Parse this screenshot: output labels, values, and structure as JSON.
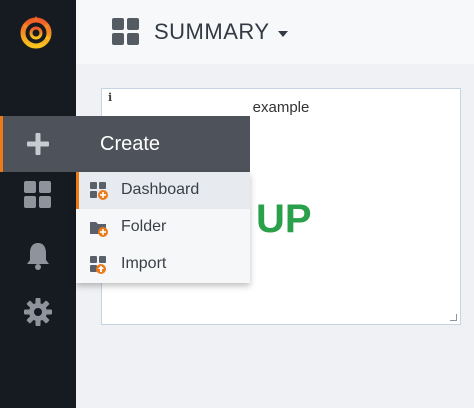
{
  "header": {
    "dashboard_title": "SUMMARY"
  },
  "panel": {
    "info_glyph": "i",
    "title": "example",
    "value": "UP",
    "value_color": "#2aa04a"
  },
  "create_menu": {
    "title": "Create",
    "items": [
      {
        "label": "Dashboard",
        "icon": "dashboard-plus-icon"
      },
      {
        "label": "Folder",
        "icon": "folder-plus-icon"
      },
      {
        "label": "Import",
        "icon": "import-icon"
      }
    ]
  },
  "sidebar": {
    "icons": [
      "grafana-logo",
      "plus-icon",
      "dashboards-icon",
      "bell-icon",
      "gear-icon"
    ]
  },
  "colors": {
    "sidebar_bg": "#161b22",
    "accent": "#eb7b18"
  }
}
